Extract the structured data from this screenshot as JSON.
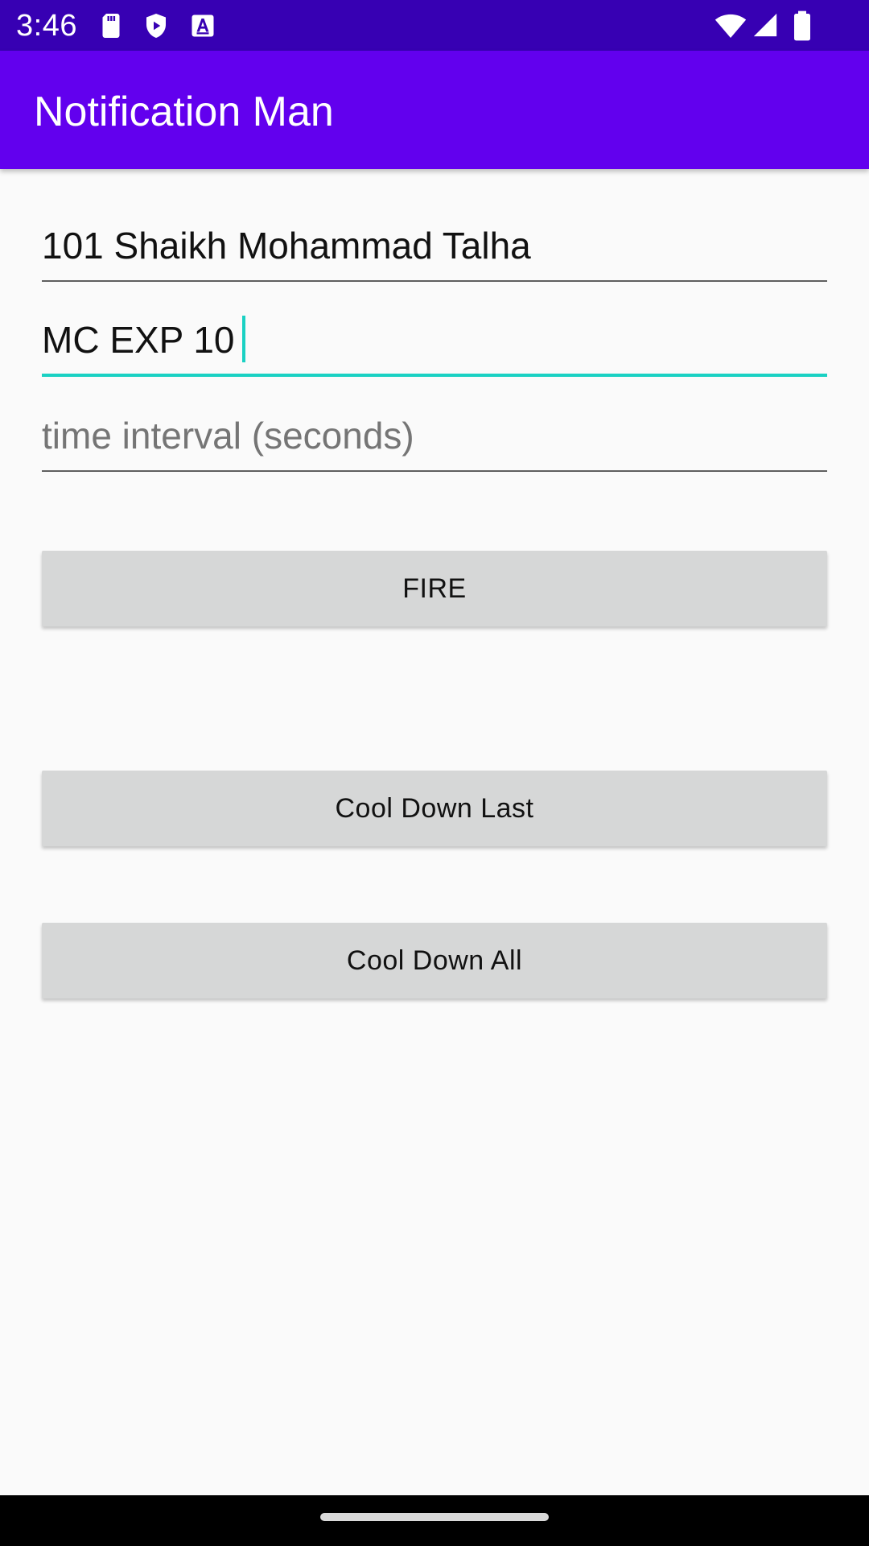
{
  "status_bar": {
    "time": "3:46",
    "icons": [
      "sd-card-icon",
      "play-protect-icon",
      "font-a-icon",
      "wifi-icon",
      "signal-icon",
      "battery-icon"
    ]
  },
  "app_bar": {
    "title": "Notification Man",
    "color": "#6200ee"
  },
  "form": {
    "name_value": "101 Shaikh Mohammad Talha",
    "message_value": "MC EXP 10",
    "interval_value": "",
    "interval_placeholder": "time interval (seconds)"
  },
  "buttons": {
    "fire_label": "FIRE",
    "cool_down_last_label": "Cool Down Last",
    "cool_down_all_label": "Cool Down All"
  },
  "colors": {
    "status_bar": "#3700b3",
    "accent": "#1ad1c3",
    "button_bg": "#d6d7d7"
  }
}
